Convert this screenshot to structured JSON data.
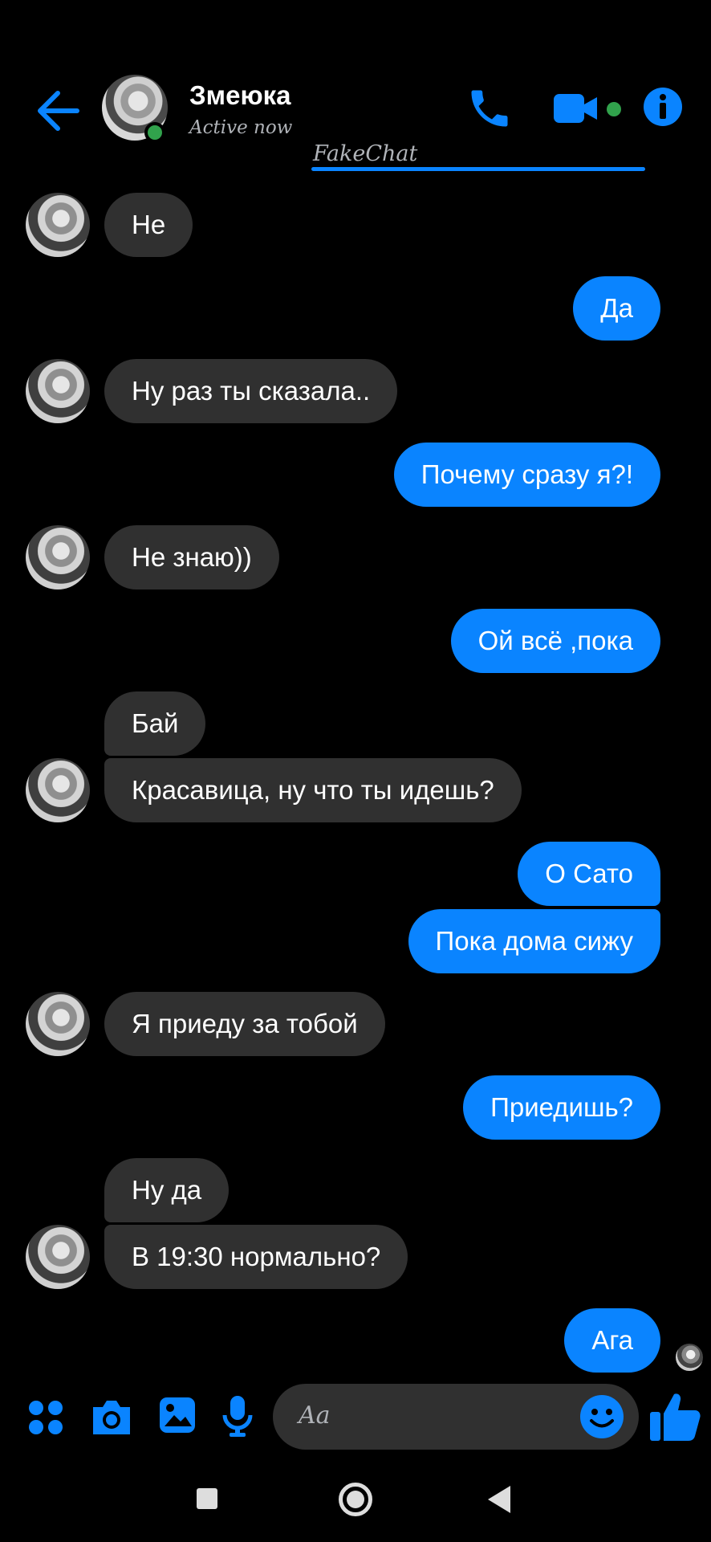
{
  "header": {
    "contact_name": "Змеюка",
    "status": "Active now",
    "watermark": "FakeChat"
  },
  "colors": {
    "accent": "#0a84ff",
    "incoming_bubble": "#303030",
    "online": "#31a24c",
    "background": "#000000"
  },
  "icons": [
    "back-arrow-icon",
    "phone-icon",
    "video-icon",
    "info-icon",
    "apps-icon",
    "camera-icon",
    "gallery-icon",
    "microphone-icon",
    "emoji-icon",
    "thumbs-up-icon"
  ],
  "messages": [
    {
      "side": "in",
      "text": "Не"
    },
    {
      "side": "out",
      "text": "Да"
    },
    {
      "side": "in",
      "text": "Ну раз ты сказала.."
    },
    {
      "side": "out",
      "text": "Почему сразу я?!"
    },
    {
      "side": "in",
      "text": "Не знаю))"
    },
    {
      "side": "out",
      "text": "Ой всё ,пока"
    },
    {
      "side": "in",
      "text": "Бай"
    },
    {
      "side": "in",
      "text": "Красавица, ну что ты идешь?"
    },
    {
      "side": "out",
      "text": "О Сато"
    },
    {
      "side": "out",
      "text": "Пока дома сижу"
    },
    {
      "side": "in",
      "text": "Я приеду за тобой"
    },
    {
      "side": "out",
      "text": "Приедишь?"
    },
    {
      "side": "in",
      "text": "Ну да"
    },
    {
      "side": "in",
      "text": "В 19:30 нормально?"
    },
    {
      "side": "out",
      "text": "Ага"
    }
  ],
  "composer": {
    "placeholder": "Aa"
  }
}
